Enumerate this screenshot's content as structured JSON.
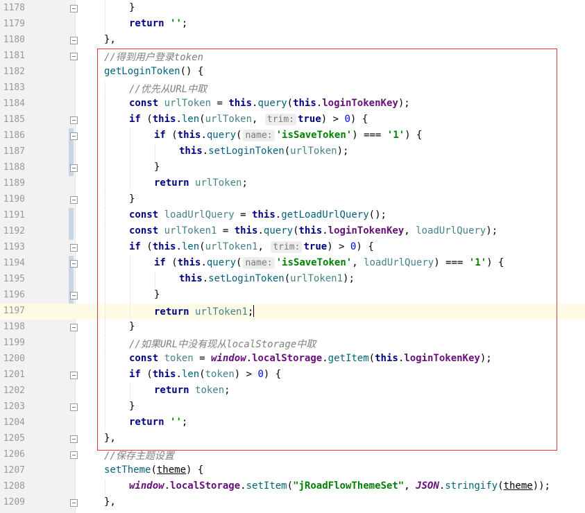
{
  "editor": {
    "current_line": "1197",
    "lines": [
      {
        "num": "1178",
        "indent": 2,
        "fold": true,
        "change": false,
        "tokens": [
          [
            "}",
            ""
          ]
        ]
      },
      {
        "num": "1179",
        "indent": 2,
        "fold": false,
        "change": false,
        "tokens": [
          [
            "return",
            "kw"
          ],
          [
            " ",
            ""
          ],
          [
            "''",
            "str"
          ],
          [
            ";",
            ""
          ]
        ]
      },
      {
        "num": "1180",
        "indent": 1,
        "fold": true,
        "change": false,
        "tokens": [
          [
            "},",
            ""
          ]
        ]
      },
      {
        "num": "1181",
        "indent": 1,
        "fold": true,
        "change": false,
        "tokens": [
          [
            "//得到用户登录token",
            "cmt"
          ]
        ]
      },
      {
        "num": "1182",
        "indent": 1,
        "fold": false,
        "change": false,
        "tokens": [
          [
            "getLoginToken",
            "fn"
          ],
          [
            "() {",
            ""
          ]
        ]
      },
      {
        "num": "1183",
        "indent": 2,
        "fold": false,
        "change": false,
        "tokens": [
          [
            "//优先从URL中取",
            "cmt"
          ]
        ]
      },
      {
        "num": "1184",
        "indent": 2,
        "fold": false,
        "change": false,
        "tokens": [
          [
            "const",
            "kw"
          ],
          [
            " ",
            ""
          ],
          [
            "urlToken",
            "var"
          ],
          [
            " = ",
            ""
          ],
          [
            "this",
            "kw"
          ],
          [
            ".",
            ""
          ],
          [
            "query",
            "fn"
          ],
          [
            "(",
            ""
          ],
          [
            "this",
            "kw"
          ],
          [
            ".",
            ""
          ],
          [
            "loginTokenKey",
            "prop"
          ],
          [
            ");",
            ""
          ]
        ]
      },
      {
        "num": "1185",
        "indent": 2,
        "fold": true,
        "change": false,
        "tokens": [
          [
            "if",
            "kw"
          ],
          [
            " (",
            ""
          ],
          [
            "this",
            "kw"
          ],
          [
            ".",
            ""
          ],
          [
            "len",
            "fn"
          ],
          [
            "(",
            ""
          ],
          [
            "urlToken",
            "var"
          ],
          [
            ", ",
            ""
          ],
          [
            "trim:",
            "hint"
          ],
          [
            "true",
            "kw"
          ],
          [
            ") > ",
            ""
          ],
          [
            "0",
            "num"
          ],
          [
            ") {",
            ""
          ]
        ]
      },
      {
        "num": "1186",
        "indent": 3,
        "fold": true,
        "change": true,
        "tokens": [
          [
            "if",
            "kw"
          ],
          [
            " (",
            ""
          ],
          [
            "this",
            "kw"
          ],
          [
            ".",
            ""
          ],
          [
            "query",
            "fn"
          ],
          [
            "(",
            ""
          ],
          [
            "name:",
            "hint"
          ],
          [
            "'isSaveToken",
            "str"
          ],
          [
            "I",
            "ibeam"
          ],
          [
            "'",
            "str"
          ],
          [
            ") === ",
            ""
          ],
          [
            "'1'",
            "str"
          ],
          [
            ") {",
            ""
          ]
        ]
      },
      {
        "num": "1187",
        "indent": 4,
        "fold": false,
        "change": true,
        "tokens": [
          [
            "this",
            "kw"
          ],
          [
            ".",
            ""
          ],
          [
            "setLoginToken",
            "fn"
          ],
          [
            "(",
            ""
          ],
          [
            "urlToken",
            "var"
          ],
          [
            ");",
            ""
          ]
        ]
      },
      {
        "num": "1188",
        "indent": 3,
        "fold": true,
        "change": true,
        "tokens": [
          [
            "}",
            ""
          ]
        ]
      },
      {
        "num": "1189",
        "indent": 3,
        "fold": false,
        "change": false,
        "tokens": [
          [
            "return",
            "kw"
          ],
          [
            " ",
            ""
          ],
          [
            "urlToken",
            "var"
          ],
          [
            ";",
            ""
          ]
        ]
      },
      {
        "num": "1190",
        "indent": 2,
        "fold": true,
        "change": false,
        "tokens": [
          [
            "}",
            ""
          ]
        ]
      },
      {
        "num": "1191",
        "indent": 2,
        "fold": false,
        "change": true,
        "tokens": [
          [
            "const",
            "kw"
          ],
          [
            " ",
            ""
          ],
          [
            "loadUrlQuery",
            "var"
          ],
          [
            " = ",
            ""
          ],
          [
            "this",
            "kw"
          ],
          [
            ".",
            ""
          ],
          [
            "getLoadUrlQuery",
            "fn"
          ],
          [
            "();",
            ""
          ]
        ]
      },
      {
        "num": "1192",
        "indent": 2,
        "fold": false,
        "change": true,
        "tokens": [
          [
            "const",
            "kw"
          ],
          [
            " ",
            ""
          ],
          [
            "urlToken1",
            "var"
          ],
          [
            " = ",
            ""
          ],
          [
            "this",
            "kw"
          ],
          [
            ".",
            ""
          ],
          [
            "query",
            "fn"
          ],
          [
            "(",
            ""
          ],
          [
            "this",
            "kw"
          ],
          [
            ".",
            ""
          ],
          [
            "loginTokenKey",
            "prop"
          ],
          [
            ", ",
            ""
          ],
          [
            "loadUrlQuery",
            "var"
          ],
          [
            ");",
            ""
          ]
        ]
      },
      {
        "num": "1193",
        "indent": 2,
        "fold": true,
        "change": false,
        "tokens": [
          [
            "if",
            "kw"
          ],
          [
            " (",
            ""
          ],
          [
            "this",
            "kw"
          ],
          [
            ".",
            ""
          ],
          [
            "len",
            "fn"
          ],
          [
            "(",
            ""
          ],
          [
            "urlToken1",
            "var"
          ],
          [
            ", ",
            ""
          ],
          [
            "trim:",
            "hint"
          ],
          [
            "true",
            "kw"
          ],
          [
            ") > ",
            ""
          ],
          [
            "0",
            "num"
          ],
          [
            ") {",
            ""
          ]
        ]
      },
      {
        "num": "1194",
        "indent": 3,
        "fold": true,
        "change": true,
        "tokens": [
          [
            "if",
            "kw"
          ],
          [
            " (",
            ""
          ],
          [
            "this",
            "kw"
          ],
          [
            ".",
            ""
          ],
          [
            "query",
            "fn"
          ],
          [
            "(",
            ""
          ],
          [
            "name:",
            "hint"
          ],
          [
            "'isSaveToken'",
            "str"
          ],
          [
            ", ",
            ""
          ],
          [
            "loadUrlQuery",
            "var"
          ],
          [
            ") === ",
            ""
          ],
          [
            "'1'",
            "str"
          ],
          [
            ") {",
            ""
          ]
        ]
      },
      {
        "num": "1195",
        "indent": 4,
        "fold": false,
        "change": true,
        "tokens": [
          [
            "this",
            "kw"
          ],
          [
            ".",
            ""
          ],
          [
            "setLoginToken",
            "fn"
          ],
          [
            "(",
            ""
          ],
          [
            "urlToken1",
            "var"
          ],
          [
            ");",
            ""
          ]
        ]
      },
      {
        "num": "1196",
        "indent": 3,
        "fold": true,
        "change": true,
        "tokens": [
          [
            "}",
            ""
          ]
        ]
      },
      {
        "num": "1197",
        "indent": 3,
        "fold": false,
        "change": false,
        "tokens": [
          [
            "return",
            "kw"
          ],
          [
            " ",
            ""
          ],
          [
            "urlToken1",
            "var"
          ],
          [
            ";",
            ""
          ],
          [
            "",
            "caret"
          ]
        ]
      },
      {
        "num": "1198",
        "indent": 2,
        "fold": true,
        "change": false,
        "tokens": [
          [
            "}",
            ""
          ]
        ]
      },
      {
        "num": "1199",
        "indent": 2,
        "fold": false,
        "change": false,
        "tokens": [
          [
            "//如果URL中没有现从localStorage中取",
            "cmt"
          ]
        ]
      },
      {
        "num": "1200",
        "indent": 2,
        "fold": false,
        "change": false,
        "tokens": [
          [
            "const",
            "kw"
          ],
          [
            " ",
            ""
          ],
          [
            "token",
            "var"
          ],
          [
            " = ",
            ""
          ],
          [
            "window",
            "win"
          ],
          [
            ".",
            ""
          ],
          [
            "localStorage",
            "prop"
          ],
          [
            ".",
            ""
          ],
          [
            "getItem",
            "fn"
          ],
          [
            "(",
            ""
          ],
          [
            "this",
            "kw"
          ],
          [
            ".",
            ""
          ],
          [
            "loginTokenKey",
            "prop"
          ],
          [
            ");",
            ""
          ]
        ]
      },
      {
        "num": "1201",
        "indent": 2,
        "fold": true,
        "change": false,
        "tokens": [
          [
            "if",
            "kw"
          ],
          [
            " (",
            ""
          ],
          [
            "this",
            "kw"
          ],
          [
            ".",
            ""
          ],
          [
            "len",
            "fn"
          ],
          [
            "(",
            ""
          ],
          [
            "token",
            "var"
          ],
          [
            ") > ",
            ""
          ],
          [
            "0",
            "num"
          ],
          [
            ") {",
            ""
          ]
        ]
      },
      {
        "num": "1202",
        "indent": 3,
        "fold": false,
        "change": false,
        "tokens": [
          [
            "return",
            "kw"
          ],
          [
            " ",
            ""
          ],
          [
            "token",
            "var"
          ],
          [
            ";",
            ""
          ]
        ]
      },
      {
        "num": "1203",
        "indent": 2,
        "fold": true,
        "change": false,
        "tokens": [
          [
            "}",
            ""
          ]
        ]
      },
      {
        "num": "1204",
        "indent": 2,
        "fold": false,
        "change": false,
        "tokens": [
          [
            "return",
            "kw"
          ],
          [
            " ",
            ""
          ],
          [
            "''",
            "str"
          ],
          [
            ";",
            ""
          ]
        ]
      },
      {
        "num": "1205",
        "indent": 1,
        "fold": true,
        "change": false,
        "tokens": [
          [
            "},",
            ""
          ]
        ]
      },
      {
        "num": "1206",
        "indent": 1,
        "fold": true,
        "change": false,
        "tokens": [
          [
            "//保存主题设置",
            "cmt"
          ]
        ]
      },
      {
        "num": "1207",
        "indent": 1,
        "fold": false,
        "change": false,
        "tokens": [
          [
            "setTheme",
            "fn"
          ],
          [
            "(",
            ""
          ],
          [
            "theme",
            "param"
          ],
          [
            ") {",
            ""
          ]
        ]
      },
      {
        "num": "1208",
        "indent": 2,
        "fold": false,
        "change": false,
        "tokens": [
          [
            "window",
            "win"
          ],
          [
            ".",
            ""
          ],
          [
            "localStorage",
            "prop"
          ],
          [
            ".",
            ""
          ],
          [
            "setItem",
            "fn"
          ],
          [
            "(",
            ""
          ],
          [
            "\"jRoadFlowThemeSet\"",
            "str"
          ],
          [
            ", ",
            ""
          ],
          [
            "JSON",
            "win"
          ],
          [
            ".",
            ""
          ],
          [
            "stringify",
            "fn"
          ],
          [
            "(",
            ""
          ],
          [
            "theme",
            "param"
          ],
          [
            "));",
            ""
          ]
        ]
      },
      {
        "num": "1209",
        "indent": 1,
        "fold": true,
        "change": false,
        "tokens": [
          [
            "},",
            ""
          ]
        ]
      }
    ]
  }
}
